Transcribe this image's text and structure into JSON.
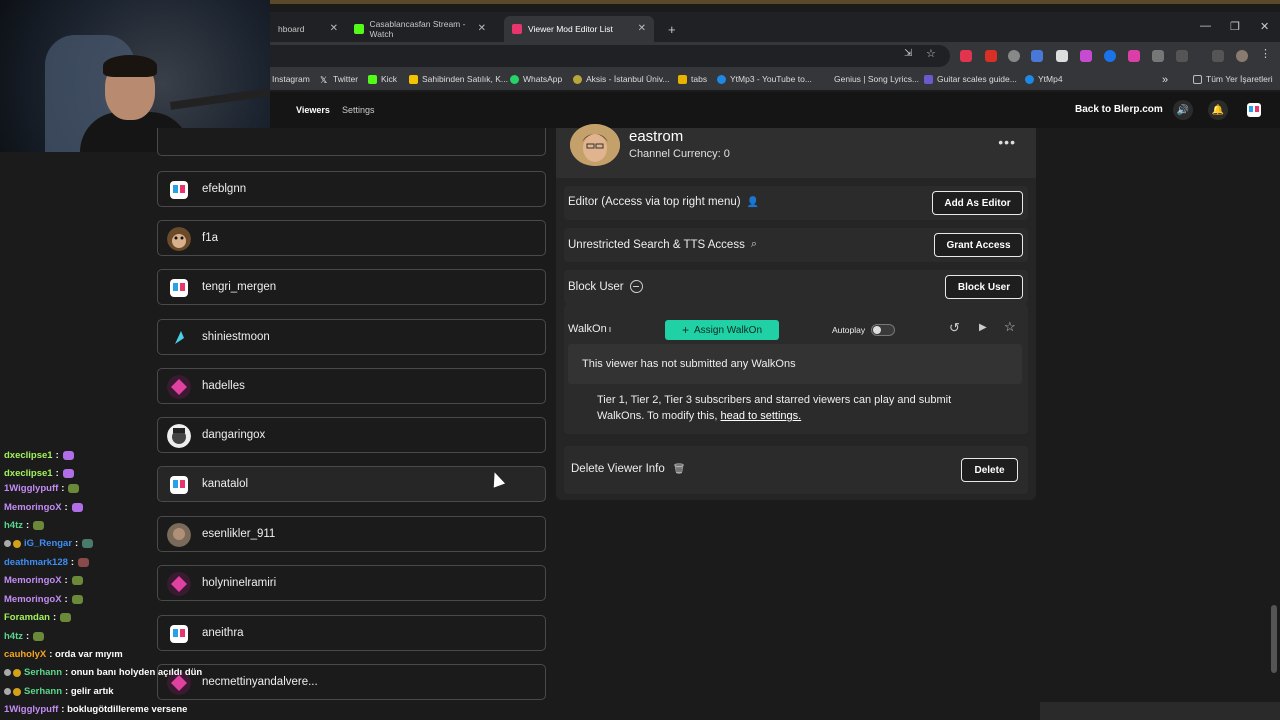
{
  "browser": {
    "tabs": [
      {
        "label": "hboard",
        "active": false
      },
      {
        "label": "Casablancasfan Stream - Watch",
        "active": false
      },
      {
        "label": "Viewer Mod Editor List",
        "active": true
      }
    ],
    "new_tab": "+",
    "bookmarks": [
      "Instagram",
      "Twitter",
      "Kick",
      "Sahibinden Satılık, K...",
      "WhatsApp",
      "Aksis - İstanbul Üniv...",
      "tabs",
      "YtMp3 - YouTube to...",
      "Genius | Song Lyrics...",
      "Guitar scales guide...",
      "YtMp4"
    ],
    "bookmarks_more": "»",
    "all_bookmarks": "Tüm Yer İşaretleri"
  },
  "site": {
    "nav": [
      {
        "label": "Viewers",
        "active": true
      },
      {
        "label": "Settings",
        "active": false
      }
    ],
    "back_link": "Back to Blerp.com"
  },
  "viewers": [
    "efeblgnn",
    "f1a",
    "tengri_mergen",
    "shiniestmoon",
    "hadelles",
    "dangaringox",
    "kanatalol",
    "esenlikler_911",
    "holyninelramiri",
    "aneithra",
    "necmettinyandalvere..."
  ],
  "profile": {
    "name": "eastrom",
    "currency": "Channel Currency: 0",
    "menu": "•••"
  },
  "sections": {
    "editor_label": "Editor (Access via top right menu)",
    "editor_button": "Add As Editor",
    "search_label": "Unrestricted Search & TTS Access",
    "search_button": "Grant Access",
    "block_label": "Block User",
    "block_button": "Block User"
  },
  "walkon": {
    "label": "WalkOn",
    "assign_button": "Assign WalkOn",
    "autoplay_label": "Autoplay",
    "autoplay_on": false,
    "notice": "This viewer has not submitted any WalkOns",
    "tiers_text": "Tier 1, Tier 2, Tier 3 subscribers and starred viewers can play and submit WalkOns. To modify this, ",
    "tiers_link": "head to settings."
  },
  "delete": {
    "label": "Delete Viewer Info",
    "button": "Delete"
  },
  "chat": [
    {
      "user": "dxeclipse1",
      "msg": ":",
      "color": "#a2f25b"
    },
    {
      "user": "dxeclipse1",
      "msg": ":",
      "color": "#a2f25b"
    },
    {
      "user": "1Wigglypuff",
      "msg": ":",
      "color": "#c38cf5"
    },
    {
      "user": "MemoringoX",
      "msg": ":",
      "color": "#c38cf5"
    },
    {
      "user": "h4tz",
      "msg": ":",
      "color": "#5bd68c"
    },
    {
      "user": "iG_Rengar",
      "msg": ":",
      "color": "#3d8ef5"
    },
    {
      "user": "deathmark128",
      "msg": ":",
      "color": "#3d8ef5"
    },
    {
      "user": "MemoringoX",
      "msg": ":",
      "color": "#c38cf5"
    },
    {
      "user": "MemoringoX",
      "msg": ":",
      "color": "#c38cf5"
    },
    {
      "user": "Foramdan",
      "msg": ":",
      "color": "#a2f25b"
    },
    {
      "user": "h4tz",
      "msg": ":",
      "color": "#5bd68c"
    },
    {
      "user": "cauholyX",
      "msg": ": orda var mıyım",
      "color": "#f5a623"
    },
    {
      "user": "Serhann",
      "msg": ": onun banı holyden açıldı dün",
      "color": "#5bd68c"
    },
    {
      "user": "Serhann",
      "msg": ": gelir artık",
      "color": "#5bd68c"
    },
    {
      "user": "1Wigglypuff",
      "msg": ": boklugötdillereme versene",
      "color": "#c38cf5"
    }
  ],
  "colors": {
    "accent": "#1fd1a4",
    "panel": "#252525",
    "background": "#1b1b1b"
  }
}
